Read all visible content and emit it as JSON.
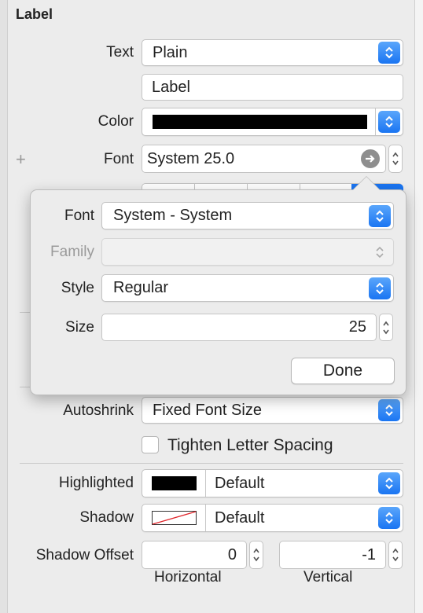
{
  "section": {
    "title": "Label"
  },
  "rows": {
    "text": {
      "label": "Text",
      "value": "Plain"
    },
    "text_value": {
      "value": "Label"
    },
    "color": {
      "label": "Color",
      "swatch": "#000000"
    },
    "font": {
      "label": "Font",
      "value": "System 25.0"
    },
    "autoshrink": {
      "label": "Autoshrink",
      "value": "Fixed Font Size"
    },
    "tighten": {
      "label": "Tighten Letter Spacing",
      "checked": false
    },
    "highlighted": {
      "label": "Highlighted",
      "value": "Default",
      "swatch": "#000000"
    },
    "shadow": {
      "label": "Shadow",
      "value": "Default"
    },
    "shadow_offset": {
      "label": "Shadow Offset",
      "horizontal": "0",
      "vertical": "-1",
      "horizontal_caption": "Horizontal",
      "vertical_caption": "Vertical"
    }
  },
  "popover": {
    "font": {
      "label": "Font",
      "value": "System - System"
    },
    "family": {
      "label": "Family",
      "value": ""
    },
    "style": {
      "label": "Style",
      "value": "Regular"
    },
    "size": {
      "label": "Size",
      "value": "25"
    },
    "done_label": "Done"
  },
  "colors": {
    "accent": "#1a75f2",
    "background": "#ececec"
  }
}
